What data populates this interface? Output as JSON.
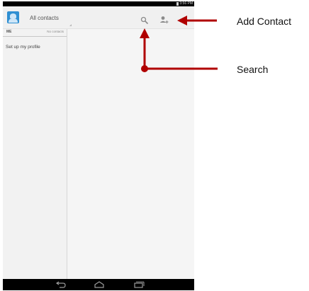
{
  "status_bar": {
    "time": "3:56 PM"
  },
  "action_bar": {
    "title": "All contacts",
    "icons": {
      "app": "contacts-app-icon",
      "search": "search-icon",
      "add_contact": "add-contact-icon"
    }
  },
  "sidebar": {
    "me_label": "ME",
    "me_count": "No contacts",
    "profile_link": "Set up my profile"
  },
  "nav_bar": {
    "icons": [
      "back-icon",
      "home-icon",
      "recent-apps-icon"
    ]
  },
  "annotations": {
    "add_contact": "Add Contact",
    "search": "Search",
    "arrow_color": "#b00000"
  }
}
